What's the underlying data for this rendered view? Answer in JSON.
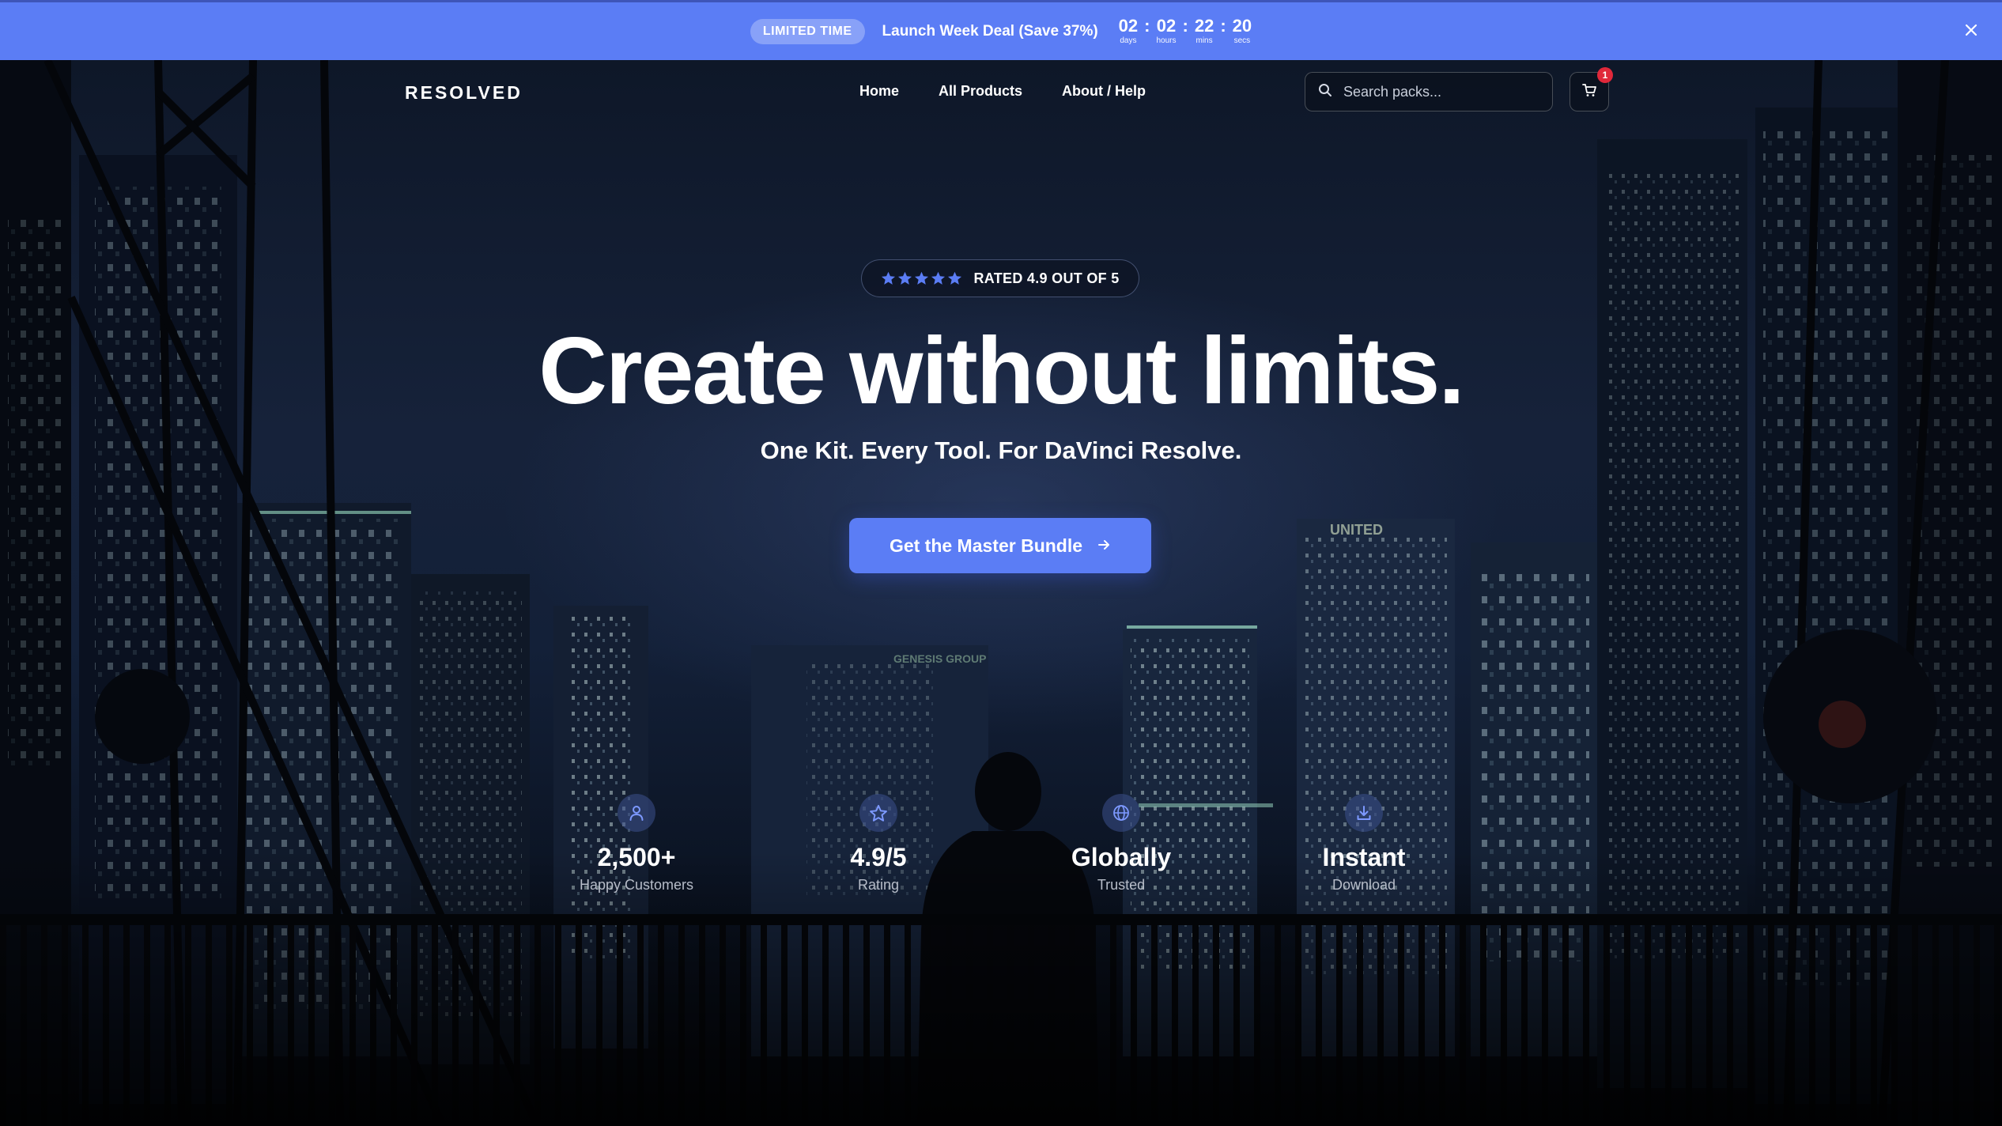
{
  "promo": {
    "badge": "LIMITED TIME",
    "text": "Launch Week Deal (Save 37%)",
    "countdown": [
      {
        "value": "02",
        "label": "days"
      },
      {
        "value": "02",
        "label": "hours"
      },
      {
        "value": "22",
        "label": "mins"
      },
      {
        "value": "20",
        "label": "secs"
      }
    ],
    "separator": ":",
    "close_icon": "close-icon"
  },
  "nav": {
    "logo": "RESOLVED",
    "links": [
      "Home",
      "All Products",
      "About / Help"
    ],
    "search_placeholder": "Search packs...",
    "cart_count": "1"
  },
  "hero": {
    "rating_text": "RATED 4.9 OUT OF 5",
    "rating_stars": 5,
    "headline": "Create without limits.",
    "subhead": "One Kit. Every Tool. For DaVinci Resolve.",
    "cta_label": "Get the Master Bundle",
    "background_signs": [
      "UNITED",
      "GENESIS GROUP"
    ]
  },
  "stats": [
    {
      "icon": "user-icon",
      "value": "2,500+",
      "label": "Happy Customers"
    },
    {
      "icon": "star-icon",
      "value": "4.9/5",
      "label": "Rating"
    },
    {
      "icon": "globe-icon",
      "value": "Globally",
      "label": "Trusted"
    },
    {
      "icon": "download-icon",
      "value": "Instant",
      "label": "Download"
    }
  ],
  "colors": {
    "accent": "#5b7df5",
    "badge_red": "#e0283a",
    "star_blue": "#5b7df5"
  }
}
